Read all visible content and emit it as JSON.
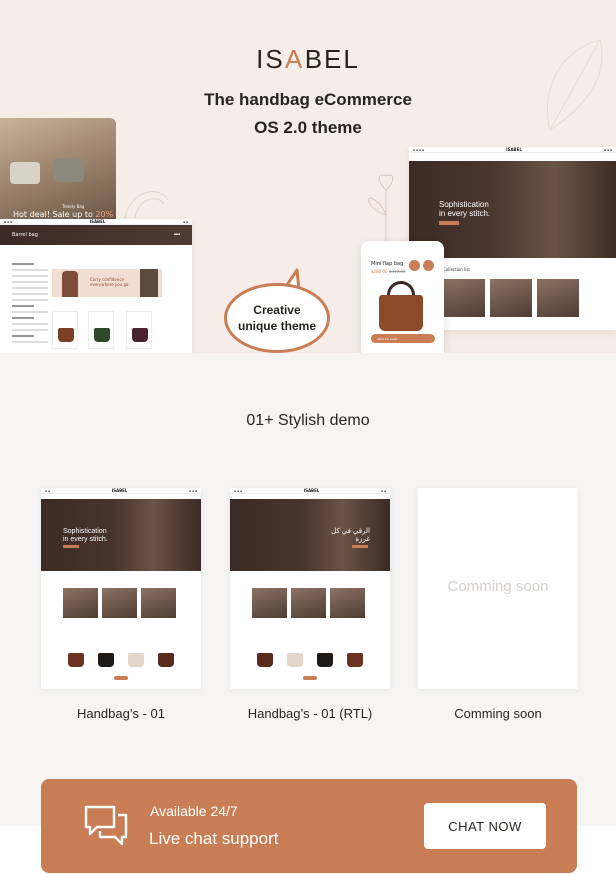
{
  "brand": {
    "logo_left": "IS",
    "logo_mark": "A",
    "logo_right": "BEL",
    "tagline_line1": "The handbag eCommerce",
    "tagline_line2": "OS 2.0 theme"
  },
  "hero": {
    "promo_photo": {
      "hot_text": "Hot deal! Sale up to",
      "hot_value": "20% off",
      "trend_label": "Trendy Bag"
    },
    "shop_page": {
      "banner_title": "Barrel bag",
      "promo_text": "Carry confidence everywhere you go"
    },
    "home_page": {
      "headline_line1": "Sophistication",
      "headline_line2": "in every stitch.",
      "section_title": "Collection list"
    },
    "phone": {
      "product_title": "Mini flap bag",
      "price": "$280.00",
      "old_price": "$310.00",
      "cart_label": "ADD TO CART"
    },
    "bubble_line1": "Creative",
    "bubble_line2": "unique theme"
  },
  "demos": {
    "heading": "01+ Stylish demo",
    "cards": [
      {
        "label": "Handbag’s - 01",
        "headline_line1": "Sophistication",
        "headline_line2": "in every stitch."
      },
      {
        "label": "Handbag’s  - 01 (RTL)",
        "headline_line1": "الرقي في كل غرزة"
      },
      {
        "label": "Comming soon",
        "placeholder": "Comming soon"
      }
    ]
  },
  "chat": {
    "availability": "Available 24/7",
    "title": "Live chat support",
    "button_label": "CHAT NOW",
    "icon": "chat-bubbles-icon"
  },
  "colors": {
    "accent": "#c87d55",
    "hero_bg": "#f6ede8",
    "dark_brown": "#3b2b25",
    "page_bg": "#f6f5f4"
  }
}
